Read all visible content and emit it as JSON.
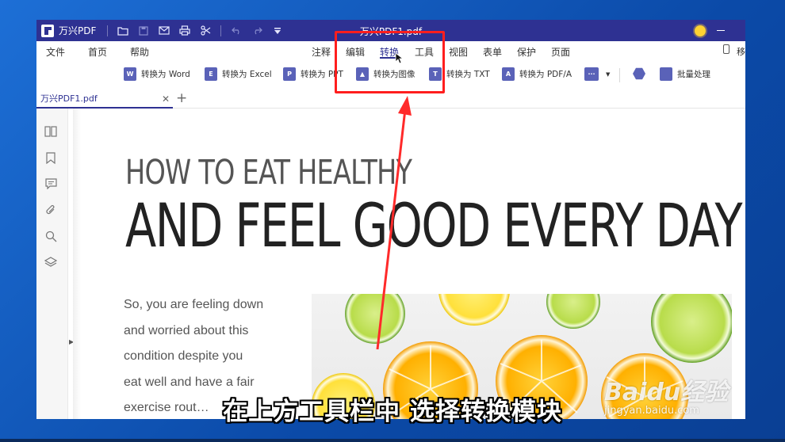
{
  "titlebar": {
    "app_name": "万兴PDF",
    "document_title": "万兴PDF1.pdf"
  },
  "menu": {
    "items": [
      "文件",
      "首页",
      "帮助",
      "注释",
      "编辑",
      "转换",
      "工具",
      "视图",
      "表单",
      "保护",
      "页面"
    ],
    "active": "转换",
    "right_label": "移"
  },
  "ribbon": {
    "to_word": "转换为 Word",
    "to_excel": "转换为 Excel",
    "to_ppt": "转换为 PPT",
    "to_image": "转换为图像",
    "to_txt": "转换为 TXT",
    "to_pdfa": "转换为 PDF/A",
    "batch": "批量处理"
  },
  "tabs": {
    "doc_tab": "万兴PDF1.pdf"
  },
  "document": {
    "heading_small": "HOW TO EAT HEALTHY",
    "heading_big": "AND FEEL GOOD EVERY DAY",
    "body_lines": [
      "So, you are feeling down",
      "and worried about this",
      "condition despite you",
      "eat well and have a fair",
      "exercise rout…"
    ]
  },
  "overlay": {
    "caption": "在上方工具栏中 选择转换模块",
    "highlight_color": "#ff1e1e",
    "watermark_brand": "Baidu经验",
    "watermark_url": "jingyan.baidu.com"
  },
  "colors": {
    "accent": "#2e3192",
    "desktop": "#1d6fd6"
  }
}
